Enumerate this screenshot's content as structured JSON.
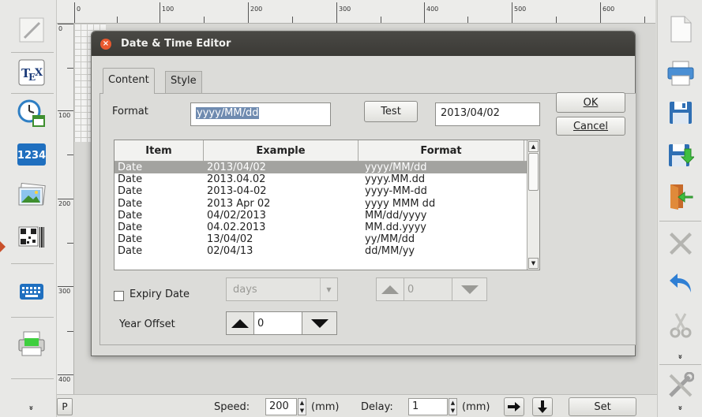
{
  "ruler_top": {
    "labels": [
      "0",
      "100",
      "200",
      "300",
      "400",
      "500",
      "600"
    ]
  },
  "ruler_left": {
    "labels": [
      "0",
      "100",
      "200",
      "300",
      "400"
    ]
  },
  "left_toolbar": {
    "items": [
      {
        "icon": "pencil-icon"
      },
      {
        "icon": "tex-icon",
        "text": "T E X"
      },
      {
        "icon": "clock-calendar-icon"
      },
      {
        "icon": "counter-icon",
        "text": "1234"
      },
      {
        "icon": "image-icon"
      },
      {
        "icon": "barcode-icon"
      },
      {
        "icon": "keyboard-icon"
      },
      {
        "icon": "printer-icon"
      }
    ],
    "more": "»"
  },
  "right_toolbar": {
    "items": [
      {
        "icon": "new-document-icon"
      },
      {
        "icon": "print-icon"
      },
      {
        "icon": "save-icon"
      },
      {
        "icon": "save-as-icon"
      },
      {
        "icon": "exit-icon"
      },
      {
        "icon": "delete-icon"
      },
      {
        "icon": "undo-icon"
      },
      {
        "icon": "cut-icon"
      },
      {
        "icon": "tools-icon"
      }
    ],
    "more": "»"
  },
  "bottom_bar": {
    "p_label": "P",
    "speed_label": "Speed:",
    "speed_value": "200",
    "speed_unit": "(mm)",
    "delay_label": "Delay:",
    "delay_value": "1",
    "delay_unit": "(mm)",
    "set_label": "Set"
  },
  "dialog": {
    "title": "Date & Time Editor",
    "tabs": {
      "content": "Content",
      "style": "Style"
    },
    "format_label": "Format",
    "format_value": "yyyy/MM/dd",
    "test_label": "Test",
    "test_result": "2013/04/02",
    "ok_label": "OK",
    "cancel_label": "Cancel",
    "table": {
      "headers": [
        "Item",
        "Example",
        "Format"
      ],
      "rows": [
        [
          "Date",
          "2013/04/02",
          "yyyy/MM/dd"
        ],
        [
          "Date",
          "2013.04.02",
          "yyyy.MM.dd"
        ],
        [
          "Date",
          "2013-04-02",
          "yyyy-MM-dd"
        ],
        [
          "Date",
          "2013 Apr 02",
          "yyyy MMM dd"
        ],
        [
          "Date",
          "04/02/2013",
          "MM/dd/yyyy"
        ],
        [
          "Date",
          "04.02.2013",
          "MM.dd.yyyy"
        ],
        [
          "Date",
          "13/04/02",
          "yy/MM/dd"
        ],
        [
          "Date",
          "02/04/13",
          "dd/MM/yy"
        ]
      ],
      "selected_row": 0
    },
    "expiry_label": "Expiry Date",
    "expiry_checked": false,
    "expiry_unit": "days",
    "expiry_value": "0",
    "year_offset_label": "Year Offset",
    "year_offset_value": "0"
  }
}
